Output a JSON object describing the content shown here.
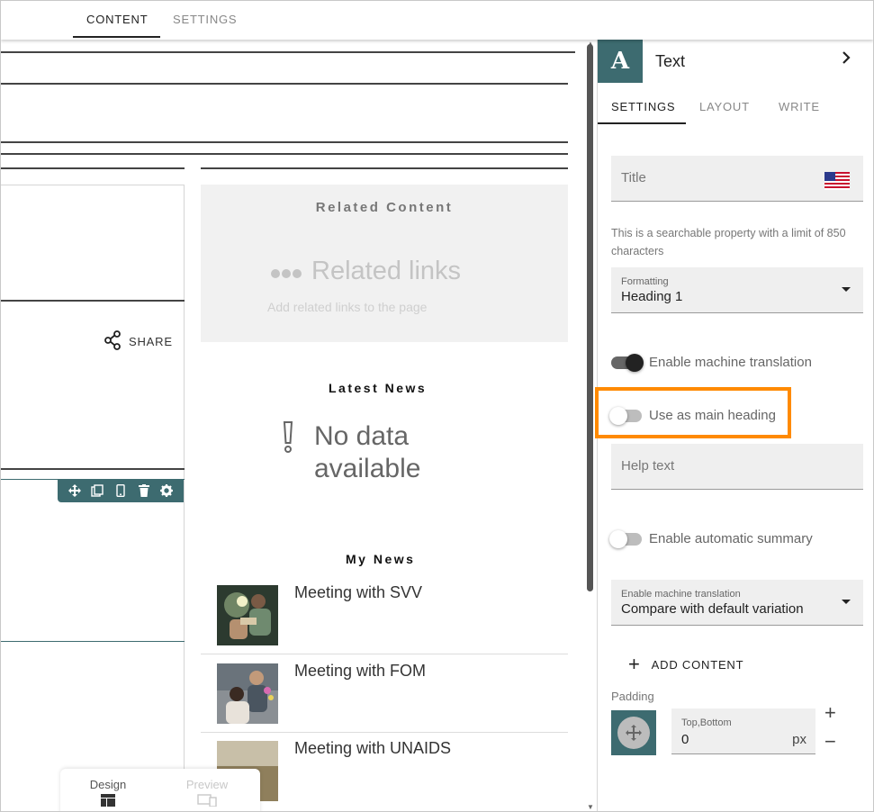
{
  "top_tabs": {
    "content": "CONTENT",
    "settings": "SETTINGS"
  },
  "canvas": {
    "share_label": "SHARE",
    "related": {
      "title": "Related Content",
      "links_label": "Related links",
      "subtitle": "Add related links to the page"
    },
    "latest_news": {
      "title": "Latest News",
      "empty": [
        "No data",
        "available"
      ]
    },
    "my_news": {
      "title": "My News",
      "items": [
        {
          "label": "Meeting with SVV"
        },
        {
          "label": "Meeting with FOM"
        },
        {
          "label": "Meeting with UNAIDS"
        }
      ]
    },
    "bottom_tabs": {
      "design": "Design",
      "preview": "Preview"
    }
  },
  "panel": {
    "icon_letter": "A",
    "title": "Text",
    "tabs": {
      "settings": "SETTINGS",
      "layout": "LAYOUT",
      "write": "WRITE"
    },
    "title_field": {
      "placeholder": "Title",
      "flag": "us-flag-icon"
    },
    "hint": "This is a searchable property with a limit of 850 characters",
    "formatting": {
      "label": "Formatting",
      "value": "Heading 1"
    },
    "machine_translation": {
      "label": "Enable machine translation",
      "on": true
    },
    "main_heading": {
      "label": "Use as main heading",
      "on": false
    },
    "help_text": {
      "placeholder": "Help text"
    },
    "auto_summary": {
      "label": "Enable automatic summary",
      "on": false
    },
    "translation_select": {
      "label": "Enable machine translation",
      "value": "Compare with default variation"
    },
    "add_content": "ADD CONTENT",
    "padding": {
      "label": "Padding",
      "field_label": "Top,Bottom",
      "value": "0",
      "unit": "px"
    }
  },
  "colors": {
    "accent": "#3d6b70",
    "highlight": "#ff8a00"
  }
}
